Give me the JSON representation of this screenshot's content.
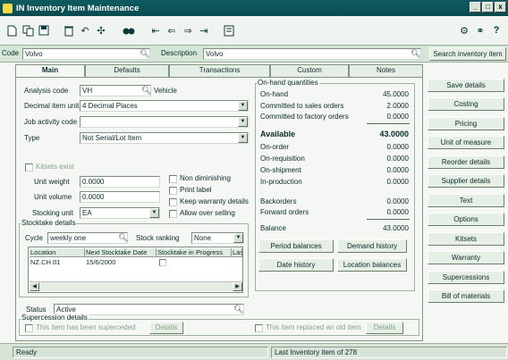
{
  "window": {
    "title": "IN Inventory Item Maintenance",
    "min": "_",
    "max": "□",
    "close": "x"
  },
  "header": {
    "code_label": "Code",
    "code_value": "Volvo",
    "description_label": "Description",
    "description_value": "Volvo",
    "search_button": "Search inventory item"
  },
  "tabs": [
    "Main",
    "Defaults",
    "Transactions",
    "Custom",
    "Notes"
  ],
  "main": {
    "analysis_code_label": "Analysis code",
    "analysis_code_value": "VH",
    "analysis_code_desc": "Vehicle",
    "decimal_label": "Decimal item unit",
    "decimal_value": "4 Decimal Places",
    "job_label": "Job activity code",
    "job_value": "",
    "type_label": "Type",
    "type_value": "Not Serial/Lot Item",
    "kitsets_label": "Kitsets exist",
    "unit_weight_label": "Unit weight",
    "unit_weight_value": "0.0000",
    "unit_volume_label": "Unit volume",
    "unit_volume_value": "0.0000",
    "stocking_unit_label": "Stocking unit",
    "stocking_unit_value": "EA",
    "non_diminishing": "Non diminishing",
    "print_label": "Print label",
    "keep_warranty": "Keep warranty details",
    "allow_over": "Allow over selling",
    "stocktake_title": "Stocktake details",
    "cycle_label": "Cycle",
    "cycle_value": "weekly one",
    "ranking_label": "Stock ranking",
    "ranking_value": "None",
    "grid_headers": [
      "Location",
      "Next Stocktake Date",
      "Stocktake in Progress",
      "Last"
    ],
    "grid_row": [
      "NZ.CH.01",
      "15/6/2000",
      "",
      ""
    ],
    "status_label": "Status",
    "status_value": "Active",
    "supersession_title": "Supercession details",
    "superceded_label": "This item has been superceded",
    "details_button": "Details",
    "replaced_label": "This item replaced an old item",
    "details_button2": "Details"
  },
  "onhand": {
    "title": "On-hand quantities",
    "rows": [
      {
        "label": "On-hand",
        "value": "45.0000"
      },
      {
        "label": "Committed to sales orders",
        "value": "2.0000"
      },
      {
        "label": "Committed to factory orders",
        "value": "0.0000"
      }
    ],
    "available_label": "Available",
    "available_value": "43.0000",
    "rows2": [
      {
        "label": "On-order",
        "value": "0.0000"
      },
      {
        "label": "On-requisition",
        "value": "0.0000"
      },
      {
        "label": "On-shipment",
        "value": "0.0000"
      },
      {
        "label": "In-production",
        "value": "0.0000"
      }
    ],
    "rows3": [
      {
        "label": "Backorders",
        "value": "0.0000"
      },
      {
        "label": "Forward orders",
        "value": "0.0000"
      }
    ],
    "balance_label": "Balance",
    "balance_value": "43.0000",
    "buttons": [
      "Period balances",
      "Demand history",
      "Date history",
      "Location balances"
    ]
  },
  "side_buttons": [
    "Save details",
    "Costing",
    "Pricing",
    "Unit of measure",
    "Reorder details",
    "Supplier details",
    "Text",
    "Options",
    "Kitsets",
    "Warranty",
    "Supercessions",
    "Bill of materials"
  ],
  "status_bar": {
    "left": "Ready",
    "right": "Last Inventory item of 278"
  }
}
